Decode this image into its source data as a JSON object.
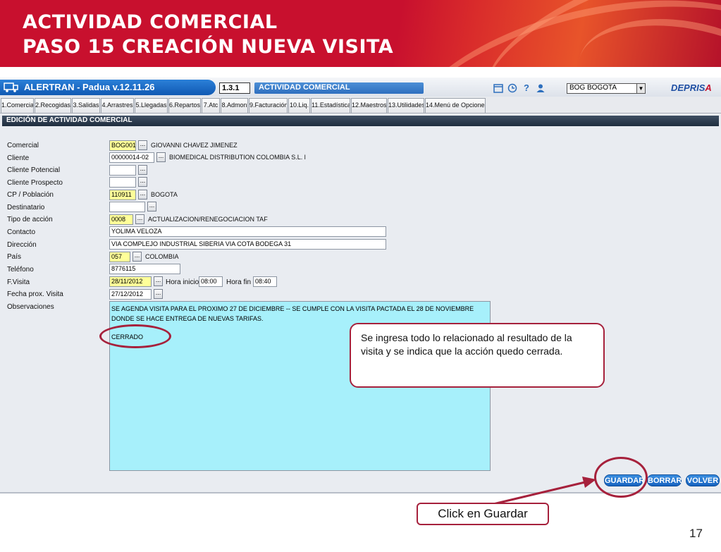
{
  "slide": {
    "title_line1": "ACTIVIDAD COMERCIAL",
    "title_line2": "PASO 15 CREACIÓN NUEVA VISITA",
    "page_number": "17"
  },
  "app": {
    "title": "ALERTRAN - Padua  v.12.11.26",
    "code": "1.3.1",
    "module": "ACTIVIDAD COMERCIAL",
    "branch": "BOG BOGOTA",
    "logo_main": "DEPRIS",
    "logo_accent": "A",
    "toolbar_icons": [
      "calendar-icon",
      "clock-icon",
      "help-icon",
      "user-icon"
    ]
  },
  "tabs": [
    "1.Comercial",
    "2.Recogidas",
    "3.Salidas",
    "4.Arrastres",
    "5.Llegadas",
    "6.Repartos",
    "7.Atc",
    "8.Admon",
    "9.Facturación",
    "10.Liq.",
    "11.Estadística",
    "12.Maestros",
    "13.Utilidades",
    "14.Menú de Opciones"
  ],
  "section_title": "EDICIÓN DE ACTIVIDAD COMERCIAL",
  "form": {
    "comercial": {
      "label": "Comercial",
      "code": "BOG001",
      "desc": "GIOVANNI CHAVEZ JIMENEZ"
    },
    "cliente": {
      "label": "Cliente",
      "code": "00000014-02",
      "desc": "BIOMEDICAL DISTRIBUTION COLOMBIA S.L. l"
    },
    "cliente_potencial": {
      "label": "Cliente Potencial",
      "code": ""
    },
    "cliente_prospecto": {
      "label": "Cliente Prospecto",
      "code": ""
    },
    "cp_poblacion": {
      "label": "CP / Población",
      "code": "110911",
      "desc": "BOGOTA"
    },
    "destinatario": {
      "label": "Destinatario",
      "code": ""
    },
    "tipo_accion": {
      "label": "Tipo de acción",
      "code": "0008",
      "desc": "ACTUALIZACION/RENEGOCIACION TAF"
    },
    "contacto": {
      "label": "Contacto",
      "value": "YOLIMA VELOZA"
    },
    "direccion": {
      "label": "Dirección",
      "value": "VIA COMPLEJO INDUSTRIAL SIBERIA VIA COTA BODEGA 31"
    },
    "pais": {
      "label": "País",
      "code": "057",
      "desc": "COLOMBIA"
    },
    "telefono": {
      "label": "Teléfono",
      "value": "8776115"
    },
    "f_visita": {
      "label": "F.Visita",
      "value": "28/11/2012"
    },
    "hora_inicio": {
      "label": "Hora inicio",
      "value": "08:00"
    },
    "hora_fin": {
      "label": "Hora fin",
      "value": "08:40"
    },
    "fecha_prox_visita": {
      "label": "Fecha prox. Visita",
      "value": "27/12/2012"
    },
    "observaciones": {
      "label": "Observaciones",
      "line1": "SE AGENDA VISITA PARA EL PROXIMO 27 DE DICIEMBRE -- SE CUMPLE CON LA VISITA PACTADA EL 28 DE NOVIEMBRE DONDE SE HACE ENTREGA DE NUEVAS TARIFAS.",
      "line2": "CERRADO"
    }
  },
  "buttons": {
    "guardar": "GUARDAR",
    "borrar": "BORRAR",
    "volver": "VOLVER"
  },
  "annotations": {
    "callout": "Se ingresa todo lo relacionado al resultado de la visita y se indica que la acción quedo cerrada.",
    "click_label": "Click en Guardar",
    "accent_color": "#a6213c"
  }
}
